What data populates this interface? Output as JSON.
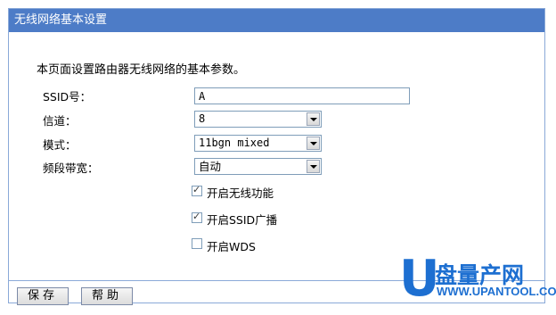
{
  "title": "无线网络基本设置",
  "intro": "本页面设置路由器无线网络的基本参数。",
  "fields": {
    "ssid": {
      "label": "SSID号：",
      "value": "A"
    },
    "channel": {
      "label": "信道：",
      "value": "8"
    },
    "mode": {
      "label": "模式：",
      "value": "11bgn mixed"
    },
    "bandwidth": {
      "label": "频段带宽：",
      "value": "自动"
    }
  },
  "checkboxes": [
    {
      "label": "开启无线功能",
      "checked": true
    },
    {
      "label": "开启SSID广播",
      "checked": true
    },
    {
      "label": "开启WDS",
      "checked": false
    }
  ],
  "buttons": {
    "save": "保存",
    "help": "帮助"
  },
  "watermark": {
    "cn": "盘量产网",
    "en": "WWW.UPANTOOL.COM",
    "u": "U"
  },
  "colors": {
    "titlebar": "#4d7cc7",
    "border": "#8aa9d8",
    "logo": "#1d6fd1"
  }
}
